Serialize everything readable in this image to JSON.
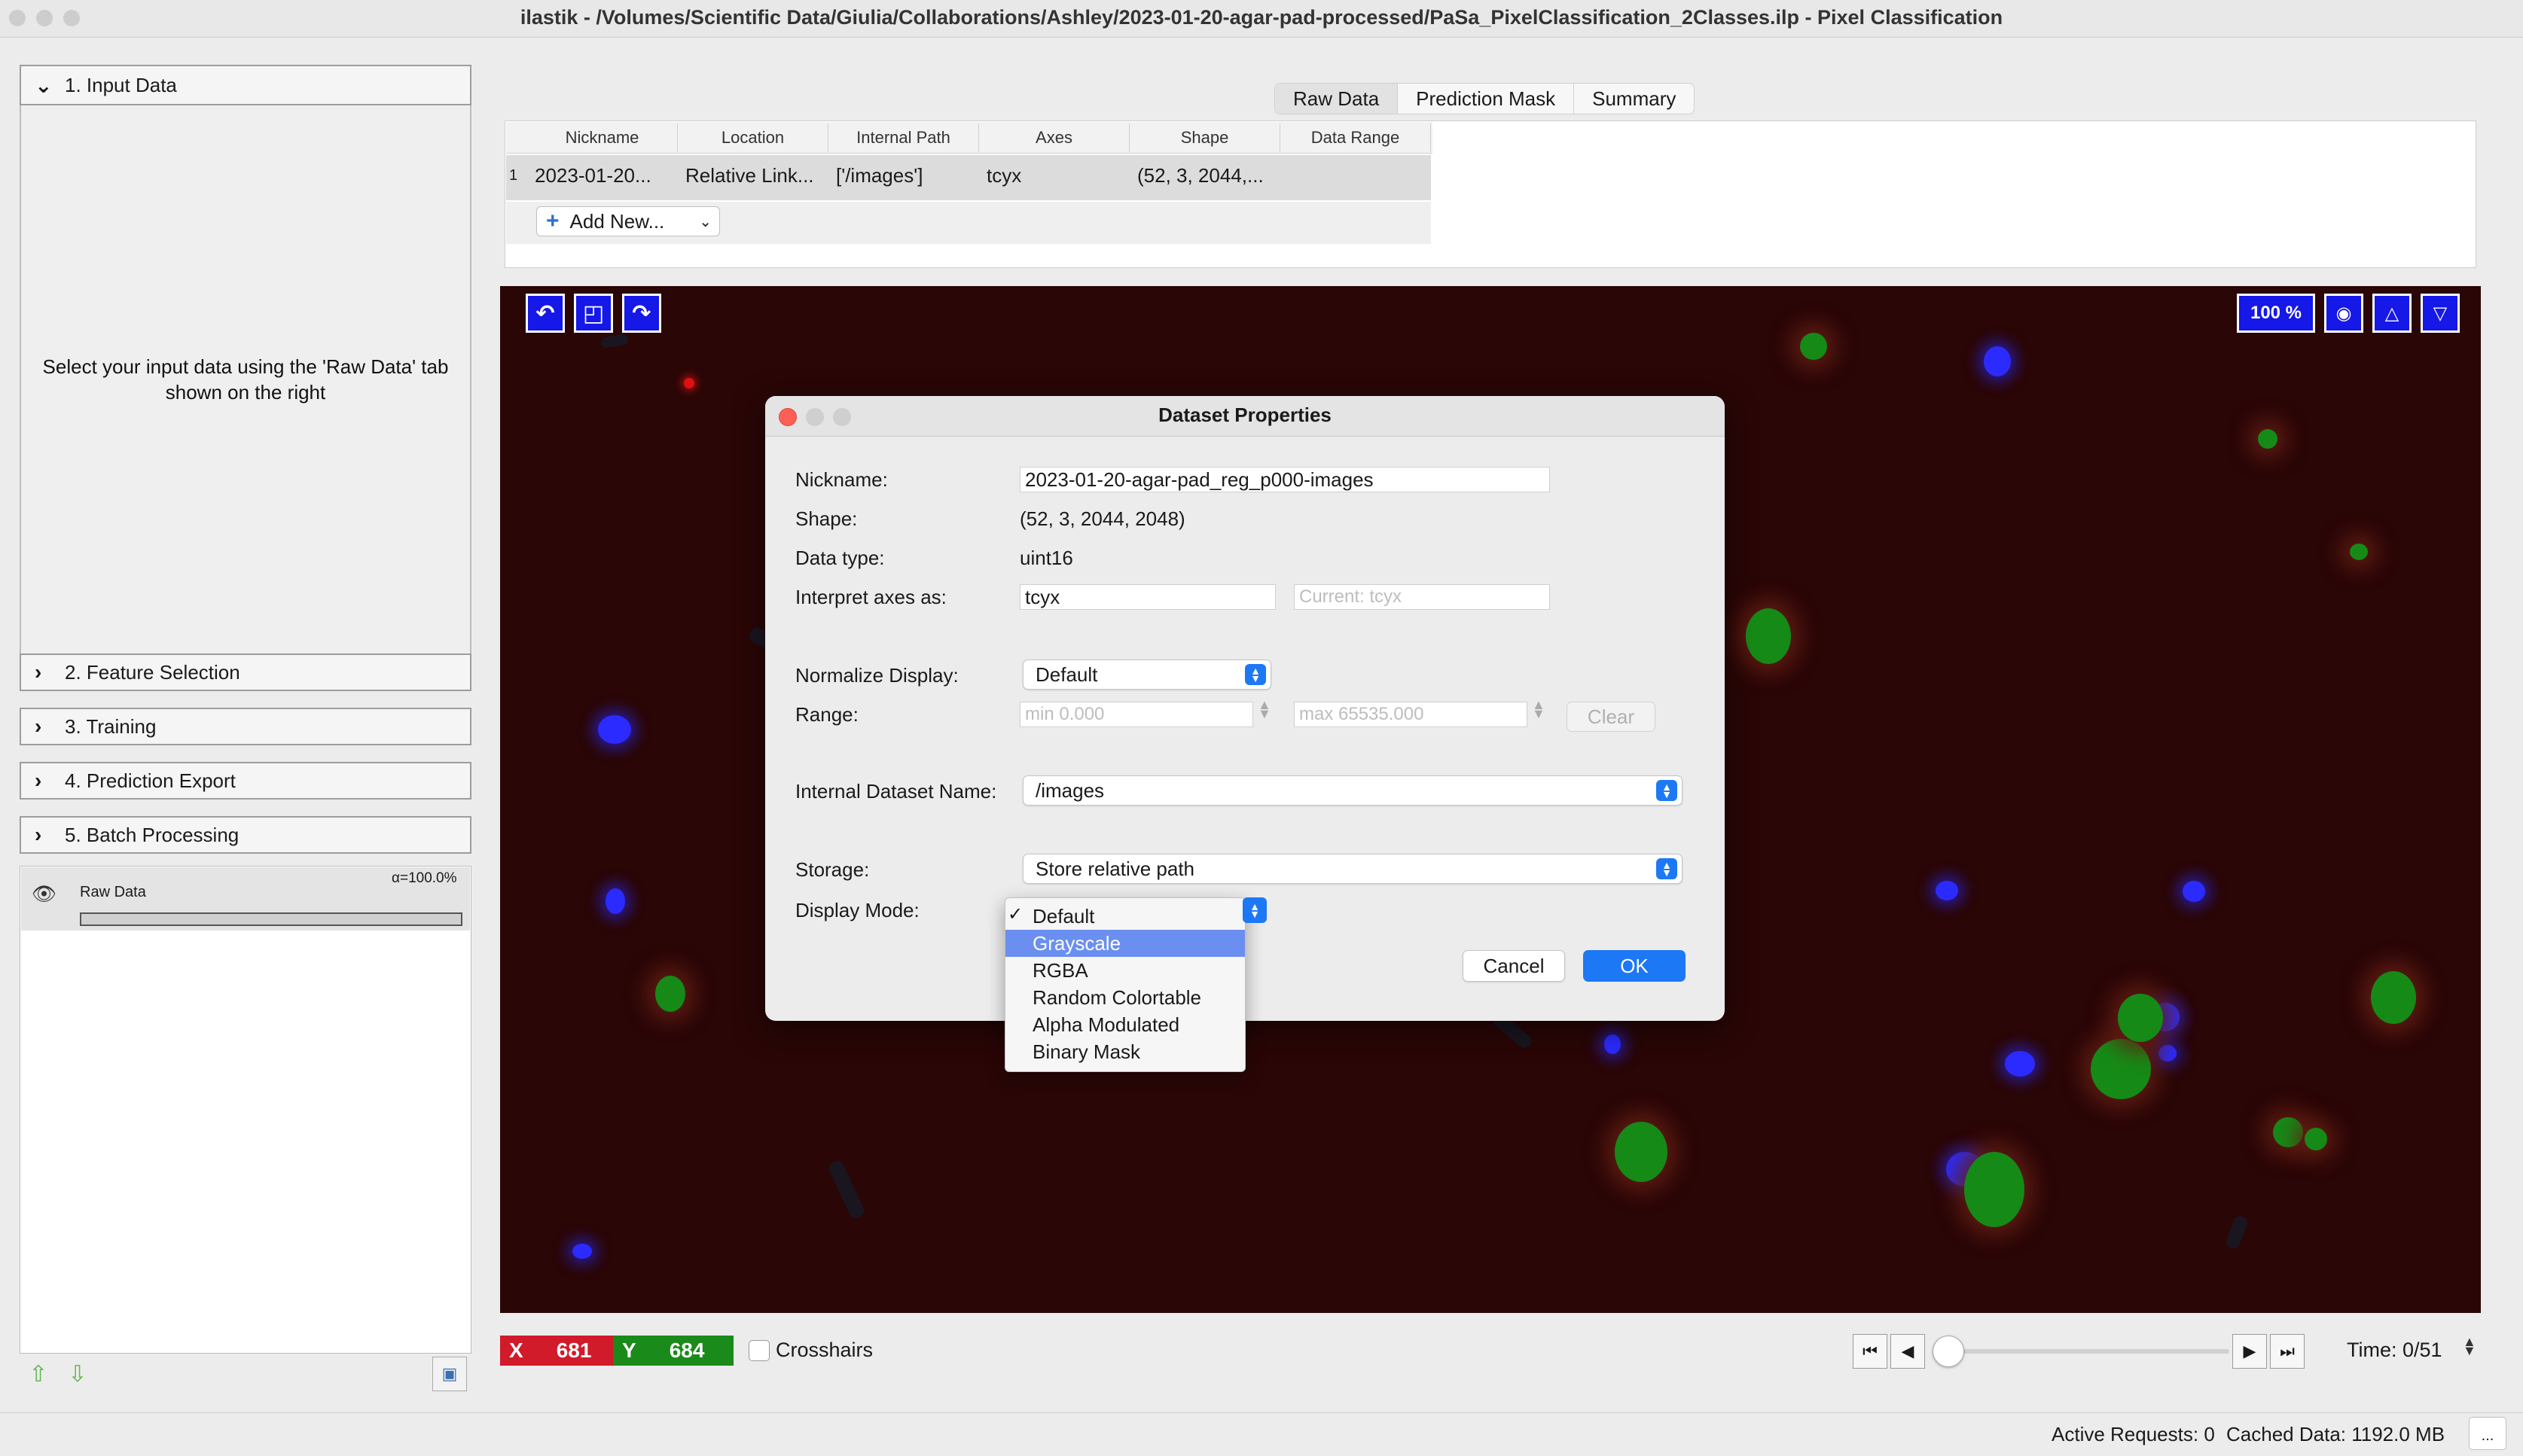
{
  "window": {
    "title": "ilastik - /Volumes/Scientific Data/Giulia/Collaborations/Ashley/2023-01-20-agar-pad-processed/PaSa_PixelClassification_2Classes.ilp - Pixel Classification"
  },
  "applets": [
    {
      "label": "1. Input Data",
      "expanded": true
    },
    {
      "label": "2. Feature Selection",
      "expanded": false
    },
    {
      "label": "3. Training",
      "expanded": false
    },
    {
      "label": "4. Prediction Export",
      "expanded": false
    },
    {
      "label": "5. Batch Processing",
      "expanded": false
    }
  ],
  "input_hint": "Select your input data using the 'Raw Data' tab shown on the right",
  "layers": [
    {
      "name": "Raw Data",
      "alpha": "α=100.0%",
      "visible": true
    }
  ],
  "tabs": [
    {
      "label": "Raw Data",
      "active": true
    },
    {
      "label": "Prediction Mask",
      "active": false
    },
    {
      "label": "Summary",
      "active": false
    }
  ],
  "table": {
    "columns": [
      "Nickname",
      "Location",
      "Internal Path",
      "Axes",
      "Shape",
      "Data Range"
    ],
    "rows": [
      {
        "num": "1",
        "cells": [
          "2023-01-20...",
          "Relative Link...",
          "['/images']",
          "tcyx",
          "(52, 3, 2044,...",
          ""
        ]
      }
    ],
    "add_new_label": "Add New..."
  },
  "viewer": {
    "zoom_label": "100 %",
    "icons": [
      "rotate-left-icon",
      "fit-view-icon",
      "rotate-right-icon",
      "camera-icon",
      "arrow-up-icon",
      "arrow-down-icon"
    ]
  },
  "coords": {
    "x_label": "X",
    "x_value": "681",
    "y_label": "Y",
    "y_value": "684"
  },
  "crosshairs_label": "Crosshairs",
  "time": {
    "label": "Time: 0/51",
    "current": 0,
    "max": 51
  },
  "status": {
    "active_requests": "Active Requests: 0",
    "cached_data": "Cached Data: 1192.0 MB",
    "more_label": "..."
  },
  "dialog": {
    "title": "Dataset Properties",
    "nickname_label": "Nickname:",
    "nickname_value": "2023-01-20-agar-pad_reg_p000-images",
    "shape_label": "Shape:",
    "shape_value": "(52, 3, 2044, 2048)",
    "dtype_label": "Data type:",
    "dtype_value": "uint16",
    "axes_label": "Interpret axes as:",
    "axes_value": "tcyx",
    "axes_current": "Current: tcyx",
    "normalize_label": "Normalize Display:",
    "normalize_value": "Default",
    "range_label": "Range:",
    "range_min": "min 0.000",
    "range_max": "max 65535.000",
    "clear_label": "Clear",
    "internal_label": "Internal Dataset Name:",
    "internal_value": "/images",
    "storage_label": "Storage:",
    "storage_value": "Store relative path",
    "display_mode_label": "Display Mode:",
    "display_mode_options": [
      "Default",
      "Grayscale",
      "RGBA",
      "Random Colortable",
      "Alpha Modulated",
      "Binary Mask"
    ],
    "display_mode_selected": "Default",
    "display_mode_highlighted": "Grayscale",
    "checkmark": "✓",
    "cancel_label": "Cancel",
    "ok_label": "OK"
  },
  "colors": {
    "viewer_bg": "#2a0606",
    "accent_blue": "#1d78f5",
    "viewer_button": "#1518e6",
    "x_coord_bg": "#d11a2a",
    "y_coord_bg": "#1a8a1a",
    "menu_highlight": "#6a8ff0"
  }
}
